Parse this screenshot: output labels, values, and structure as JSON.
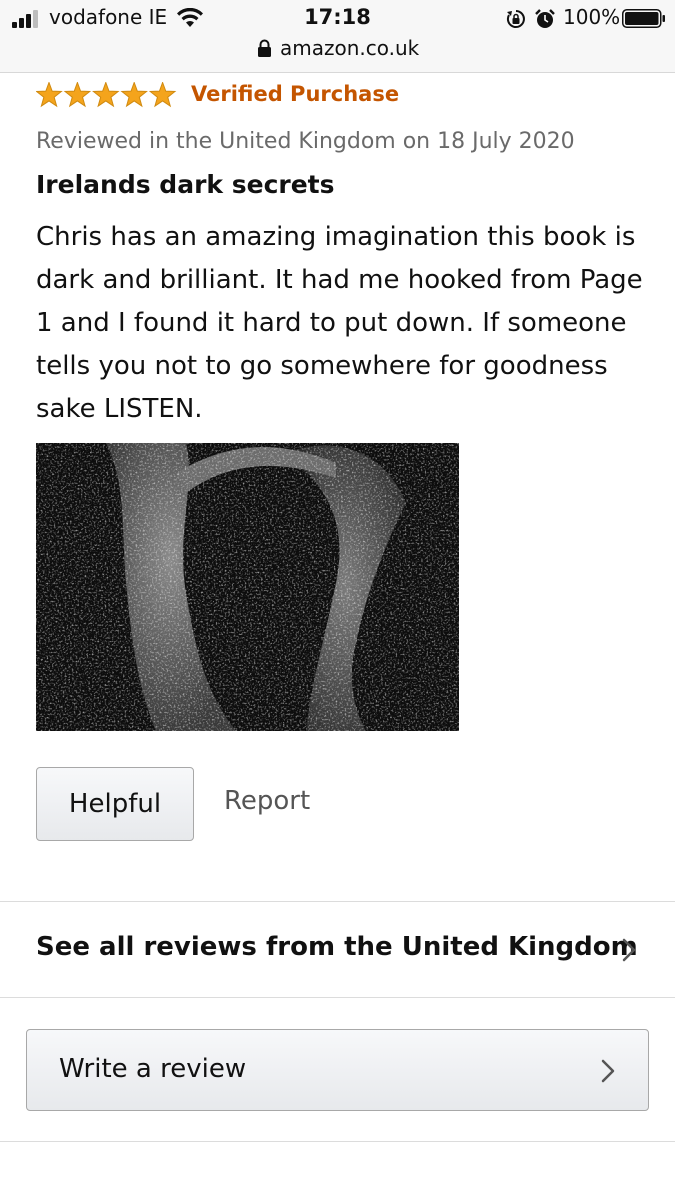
{
  "status_bar": {
    "carrier": "vodafone IE",
    "time": "17:18",
    "battery_percent": "100%",
    "battery_level": 1.0,
    "signal_bars_filled": 3,
    "signal_bars_total": 4,
    "url": "amazon.co.uk"
  },
  "review": {
    "rating": 5,
    "rating_max": 5,
    "star_color": "#f4a41c",
    "verified_label": "Verified Purchase",
    "verified_color": "#c45500",
    "date": "Reviewed in the United Kingdom on 18 July 2020",
    "title": "Irelands dark secrets",
    "body": "Chris has an amazing imagination this book is dark and brilliant. It had me hooked from Page 1 and I found it hard to put down. If someone tells you not to go somewhere for goodness sake LISTEN.",
    "image_icon": "review-photo"
  },
  "actions": {
    "helpful_label": "Helpful",
    "report_label": "Report"
  },
  "links": {
    "see_all_label": "See all reviews from the United Kingdom",
    "write_review_label": "Write a review"
  }
}
